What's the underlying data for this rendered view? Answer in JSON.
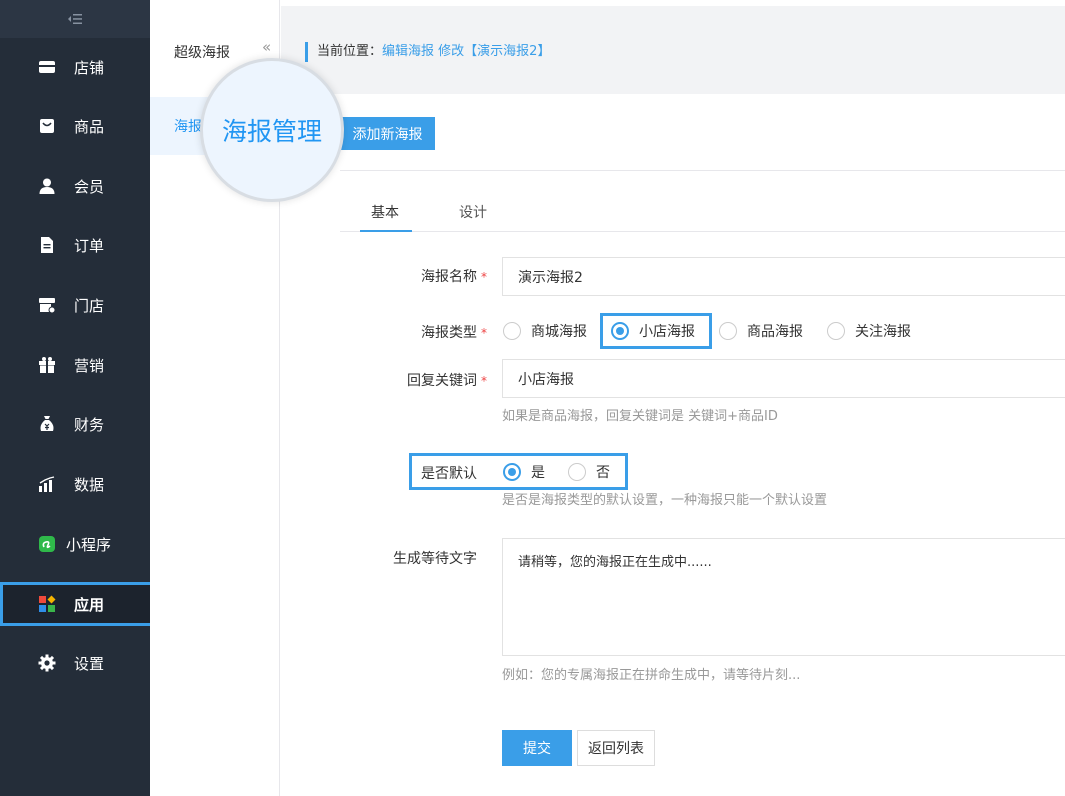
{
  "sidebar": {
    "toggle_icon": "collapse-left-icon",
    "items": [
      {
        "label": "店铺",
        "icon": "shop-icon"
      },
      {
        "label": "商品",
        "icon": "bag-icon"
      },
      {
        "label": "会员",
        "icon": "user-icon"
      },
      {
        "label": "订单",
        "icon": "document-icon"
      },
      {
        "label": "门店",
        "icon": "store-icon"
      },
      {
        "label": "营销",
        "icon": "gift-icon"
      },
      {
        "label": "财务",
        "icon": "money-bag-icon"
      },
      {
        "label": "数据",
        "icon": "bar-chart-icon"
      },
      {
        "label": "小程序",
        "icon": "mini-program-icon"
      },
      {
        "label": "应用",
        "icon": "apps-grid-icon",
        "active": true
      },
      {
        "label": "设置",
        "icon": "gear-icon"
      }
    ]
  },
  "subnav": {
    "title": "超级海报",
    "item": "海报",
    "magnified_label": "海报管理",
    "collapse_glyph": "«"
  },
  "breadcrumb": {
    "label": "当前位置：",
    "link1": "编辑海报",
    "link2": "修改【演示海报2】"
  },
  "toolbar": {
    "add_label": "添加新海报"
  },
  "tabs": [
    {
      "label": "基本",
      "active": true
    },
    {
      "label": "设计",
      "active": false
    }
  ],
  "form": {
    "name": {
      "label": "海报名称",
      "required": "*",
      "value": "演示海报2"
    },
    "type": {
      "label": "海报类型",
      "required": "*",
      "options": [
        "商城海报",
        "小店海报",
        "商品海报",
        "关注海报"
      ],
      "selected": "小店海报"
    },
    "keyword": {
      "label": "回复关键词",
      "required": "*",
      "value": "小店海报",
      "help": "如果是商品海报，回复关键词是 关键词+商品ID"
    },
    "default": {
      "label": "是否默认",
      "options": [
        "是",
        "否"
      ],
      "selected": "是",
      "help": "是否是海报类型的默认设置，一种海报只能一个默认设置"
    },
    "wait_text": {
      "label": "生成等待文字",
      "value": "请稍等，您的海报正在生成中......",
      "help": "例如：您的专属海报正在拼命生成中，请等待片刻..."
    }
  },
  "actions": {
    "submit_label": "提交",
    "back_label": "返回列表"
  },
  "colors": {
    "sidebar_bg": "#242d39",
    "accent": "#3a9ee8",
    "required": "#e44444"
  }
}
